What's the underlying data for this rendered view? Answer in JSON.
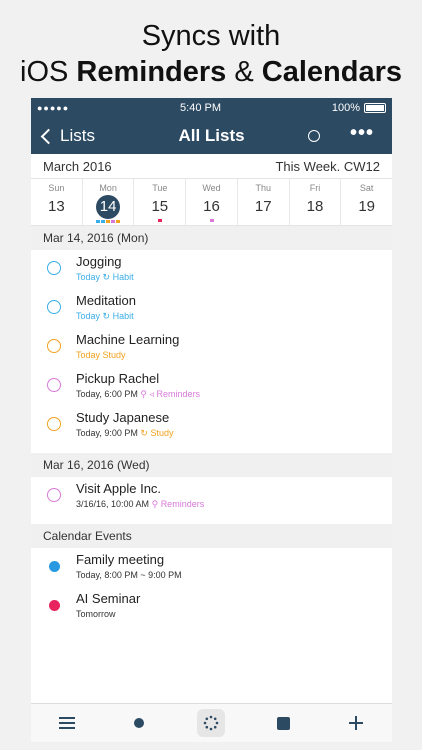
{
  "headline": {
    "line1": "Syncs with",
    "line2_a": "iOS ",
    "line2_b": "Reminders",
    "line2_c": " & ",
    "line2_d": "Calendars"
  },
  "status": {
    "signal": "●●●●●",
    "time": "5:40 PM",
    "battery": "100%"
  },
  "nav": {
    "back": "Lists",
    "title": "All Lists"
  },
  "month": {
    "label": "March 2016",
    "week": "This Week. CW12"
  },
  "week": [
    {
      "name": "Sun",
      "num": "13"
    },
    {
      "name": "Mon",
      "num": "14"
    },
    {
      "name": "Tue",
      "num": "15"
    },
    {
      "name": "Wed",
      "num": "16"
    },
    {
      "name": "Thu",
      "num": "17"
    },
    {
      "name": "Fri",
      "num": "18"
    },
    {
      "name": "Sat",
      "num": "19"
    }
  ],
  "sections": {
    "s1": "Mar 14, 2016 (Mon)",
    "s2": "Mar 16, 2016 (Wed)",
    "s3": "Calendar Events"
  },
  "tasks": [
    {
      "title": "Jogging",
      "when": "Today",
      "list": "Habit",
      "color": "#3aaee8"
    },
    {
      "title": "Meditation",
      "when": "Today",
      "list": "Habit",
      "color": "#3aaee8"
    },
    {
      "title": "Machine Learning",
      "when": "Today",
      "list": "Study",
      "color": "#f0a21e"
    },
    {
      "title": "Pickup Rachel",
      "when": "Today, 6:00 PM",
      "list": "Reminders",
      "color": "#d87ad9"
    },
    {
      "title": "Study Japanese",
      "when": "Today, 9:00 PM",
      "list": "Study",
      "color": "#f0a21e"
    },
    {
      "title": "Visit Apple Inc.",
      "when": "3/16/16, 10:00 AM",
      "list": "Reminders",
      "color": "#d87ad9"
    }
  ],
  "events": [
    {
      "title": "Family meeting",
      "when": "Today, 8:00 PM ~ 9:00 PM",
      "color": "#2899e0"
    },
    {
      "title": "AI Seminar",
      "when": "Tomorrow",
      "color": "#e8245f"
    }
  ],
  "colors": {
    "nav": "#2d4a63"
  }
}
